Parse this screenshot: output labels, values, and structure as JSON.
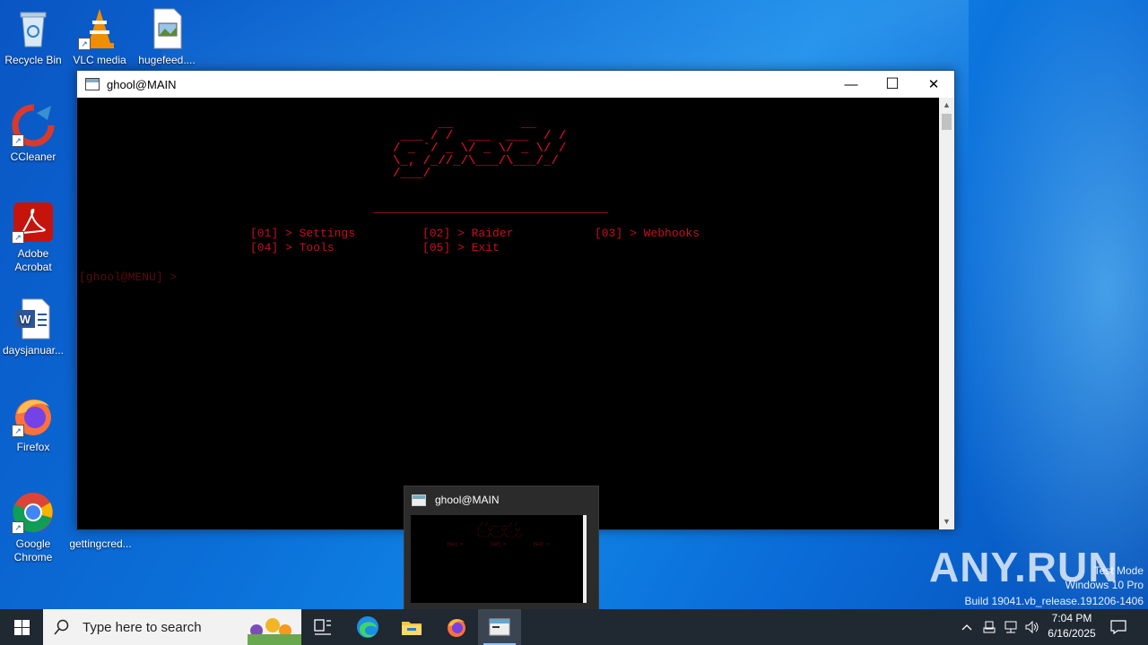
{
  "desktop": {
    "icons": [
      {
        "label": "Recycle Bin"
      },
      {
        "label": "VLC media"
      },
      {
        "label": "hugefeed...."
      },
      {
        "label": "CCleaner"
      },
      {
        "label": "Adobe Acrobat"
      },
      {
        "label": "daysjanuar..."
      },
      {
        "label": "Firefox"
      },
      {
        "label": "Google Chrome"
      },
      {
        "label": "gettingcred..."
      }
    ]
  },
  "window": {
    "title": "ghool@MAIN",
    "minimize_glyph": "—",
    "maximize_glyph": "☐",
    "close_glyph": "✕"
  },
  "console": {
    "ascii_art": "      __         __\n ___ / /  ___  ___  / /\n/ _ `/ _ \\/ _ \\/ _ \\/ /\n\\_, /_//_/\\___/\\___/_/\n/___/",
    "menu": [
      {
        "text": "[01] > Settings"
      },
      {
        "text": "[02] > Raider"
      },
      {
        "text": "[03] > Webhooks"
      },
      {
        "text": "[04] > Tools"
      },
      {
        "text": "[05] > Exit"
      }
    ],
    "prompt": "[ghool@MENU] > "
  },
  "preview": {
    "title": "ghool@MAIN"
  },
  "watermark": {
    "brand": "ANY.RUN",
    "line1": "Test Mode",
    "line2": "Windows 10 Pro",
    "line3": "Build 19041.vb_release.191206-1406"
  },
  "taskbar": {
    "search_placeholder": "Type here to search",
    "time": "7:04 PM",
    "date": "6/16/2025"
  },
  "colors": {
    "console_text": "#c50f1f",
    "taskbar": "#202832"
  }
}
